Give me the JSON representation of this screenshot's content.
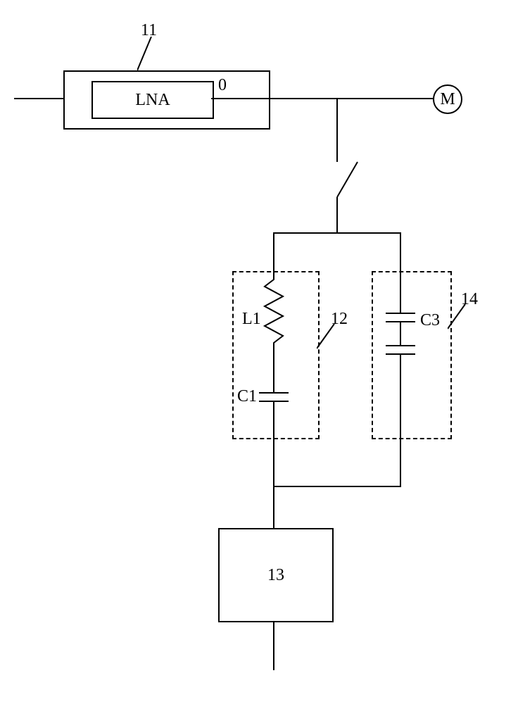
{
  "labels": {
    "block11": "11",
    "lna": "LNA",
    "output0": "0",
    "meterM": "M",
    "block12": "12",
    "block14": "14",
    "inductor": "L1",
    "cap1": "C1",
    "cap3": "C3",
    "block13": "13"
  },
  "chart_data": {
    "type": "schematic-diagram",
    "blocks": [
      {
        "id": "11",
        "contains": "LNA",
        "outputs": [
          "0"
        ]
      },
      {
        "id": "12",
        "contains": [
          "L1",
          "C1"
        ],
        "style": "dashed"
      },
      {
        "id": "14",
        "contains": [
          "C3"
        ],
        "style": "dashed"
      },
      {
        "id": "13",
        "style": "solid"
      }
    ],
    "nodes": [
      "M"
    ],
    "connections": [
      {
        "from": "input-left",
        "to": "11-in"
      },
      {
        "from": "11-out-0",
        "to": "M"
      },
      {
        "from": "branch-off-main",
        "to": "switch-open"
      },
      {
        "from": "switch",
        "to": [
          "12-top",
          "14-top"
        ]
      },
      {
        "from": "12-bottom",
        "to": "13-top"
      },
      {
        "from": "14-bottom",
        "to": "13-top"
      },
      {
        "from": "13-bottom",
        "to": "out-bottom"
      }
    ]
  }
}
